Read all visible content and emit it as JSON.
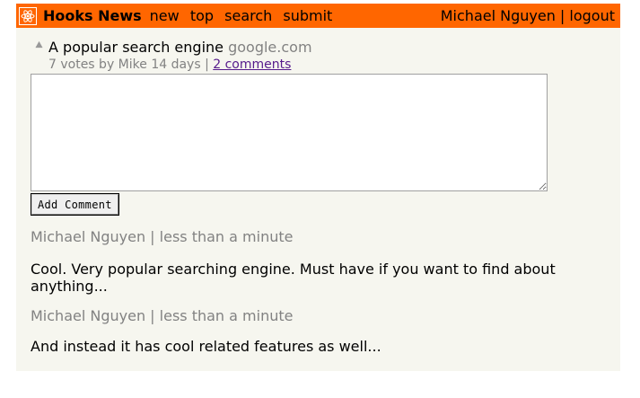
{
  "header": {
    "brand": "Hooks News",
    "logo_icon": "atom-icon",
    "nav": [
      "new",
      "top",
      "search",
      "submit"
    ],
    "user": "Michael Nguyen",
    "separator": " | ",
    "logout": "logout",
    "color": "#ff6600"
  },
  "story": {
    "vote_icon": "upvote-arrow-icon",
    "title": "A popular search engine",
    "domain": "google.com",
    "subtext": "7 votes by Mike 14 days | ",
    "comments_link": "2 comments"
  },
  "comment_form": {
    "textarea_value": "",
    "button_label": "Add Comment"
  },
  "comments": [
    {
      "author": "Michael Nguyen",
      "separator": " | ",
      "time": "less than a minute",
      "text": "Cool. Very popular searching engine. Must have if you want to find about anything..."
    },
    {
      "author": "Michael Nguyen",
      "separator": " | ",
      "time": "less than a minute",
      "text": "And instead it has cool related features as well..."
    }
  ]
}
